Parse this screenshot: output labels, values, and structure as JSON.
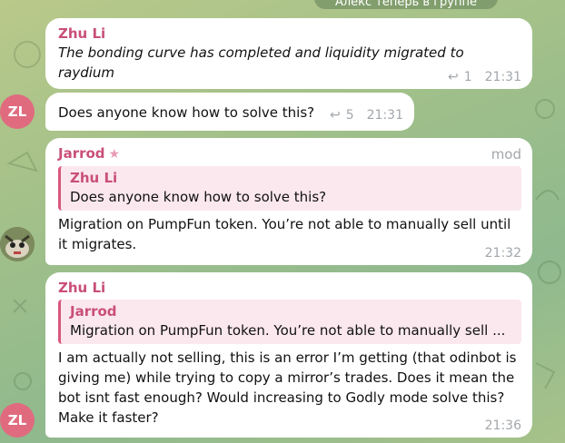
{
  "top_pill": {
    "text": "Алекс теперь в группе"
  },
  "messages": [
    {
      "sender": "Zhu Li",
      "text": "The bonding curve has completed and liquidity migrated to raydium",
      "replies": "1",
      "time": "21:31"
    },
    {
      "avatar": "ZL",
      "text": "Does anyone know how to solve this?",
      "replies": "5",
      "time": "21:31"
    },
    {
      "sender": "Jarrod",
      "role": "mod",
      "quote": {
        "name": "Zhu Li",
        "text": "Does anyone know how to solve this?"
      },
      "text_lines": [
        "Migration on PumpFun token. You’re not able to manually sell until",
        "it migrates."
      ],
      "time": "21:32"
    },
    {
      "sender": "Zhu Li",
      "avatar": "ZL",
      "quote": {
        "name": "Jarrod",
        "text": "Migration on PumpFun token. You’re not able to manually sell ..."
      },
      "text_lines": [
        "I am actually not selling, this is an error I’m getting (that odinbot is",
        "giving me) while trying to copy a mirror’s trades. Does it mean the",
        "bot isnt fast enough? Would increasing to Godly mode solve this?",
        "Make it faster?"
      ],
      "time": "21:36"
    }
  ],
  "colors": {
    "accent": "#c94f78",
    "quote_bg": "#fbe8ee",
    "avatar_zl": "#e06b7f"
  }
}
